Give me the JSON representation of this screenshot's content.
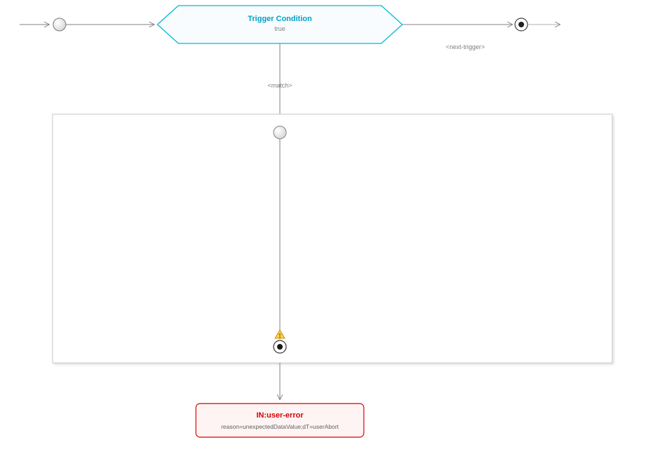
{
  "trigger": {
    "title": "Trigger Condition",
    "value": "true"
  },
  "edges": {
    "match": "<match>",
    "next_trigger": "<next-trigger>"
  },
  "error": {
    "title": "IN:user-error",
    "detail": "reason=unexpectedDataValue;dT=userAbort"
  }
}
